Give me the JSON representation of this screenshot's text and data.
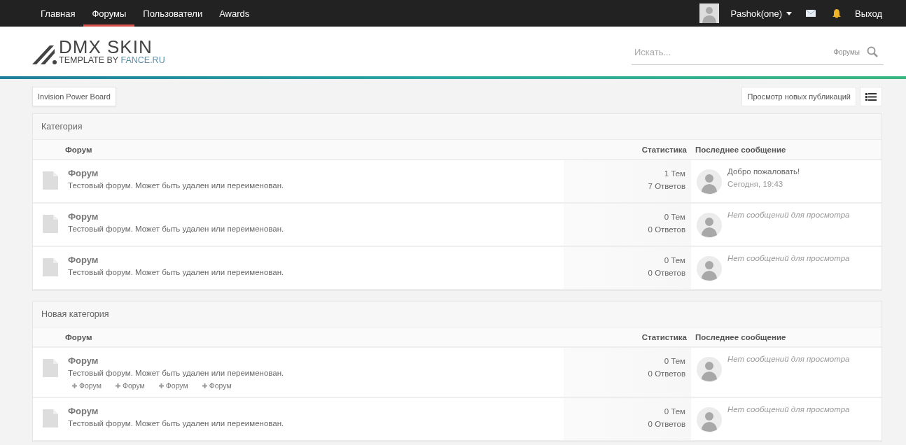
{
  "nav": {
    "items": [
      {
        "label": "Главная",
        "selected": false
      },
      {
        "label": "Форумы",
        "selected": true
      },
      {
        "label": "Пользователи",
        "selected": false
      },
      {
        "label": "Awards",
        "selected": false
      }
    ],
    "user": {
      "name": "Pashok(one)"
    },
    "logout": "Выход"
  },
  "logo": {
    "title": "DMX SKIN",
    "prefix": "TEMPLATE BY",
    "link": "FANCE.RU"
  },
  "search": {
    "placeholder": "Искать...",
    "scope": "Форумы"
  },
  "breadcrumb": "Invision Power Board",
  "new_content": "Просмотр новых публикаций",
  "categories": [
    {
      "title": "Категория",
      "columns": [
        "Форум",
        "Статистика",
        "Последнее сообщение"
      ],
      "forums": [
        {
          "name": "Форум",
          "description": "Тестовый форум. Может быть удален или переименован.",
          "topics": "1 Тем",
          "replies": "7 Ответов",
          "last_post": {
            "kind": "post",
            "title": "Добро пожаловать!",
            "date": "Сегодня, 19:43"
          }
        },
        {
          "name": "Форум",
          "description": "Тестовый форум. Может быть удален или переименован.",
          "topics": "0 Тем",
          "replies": "0 Ответов",
          "last_post": {
            "kind": "empty",
            "text": "Нет сообщений для просмотра"
          }
        },
        {
          "name": "Форум",
          "description": "Тестовый форум. Может быть удален или переименован.",
          "topics": "0 Тем",
          "replies": "0 Ответов",
          "last_post": {
            "kind": "empty",
            "text": "Нет сообщений для просмотра"
          }
        }
      ]
    },
    {
      "title": "Новая категория",
      "columns": [
        "Форум",
        "Статистика",
        "Последнее сообщение"
      ],
      "forums": [
        {
          "name": "Форум",
          "description": "Тестовый форум. Может быть удален или переименован.",
          "subforums": [
            "Форум",
            "Форум",
            "Форум",
            "Форум"
          ],
          "topics": "0 Тем",
          "replies": "0 Ответов",
          "last_post": {
            "kind": "empty",
            "text": "Нет сообщений для просмотра"
          }
        },
        {
          "name": "Форум",
          "description": "Тестовый форум. Может быть удален или переименован.",
          "topics": "0 Тем",
          "replies": "0 Ответов",
          "last_post": {
            "kind": "empty",
            "text": "Нет сообщений для просмотра"
          }
        }
      ]
    }
  ]
}
